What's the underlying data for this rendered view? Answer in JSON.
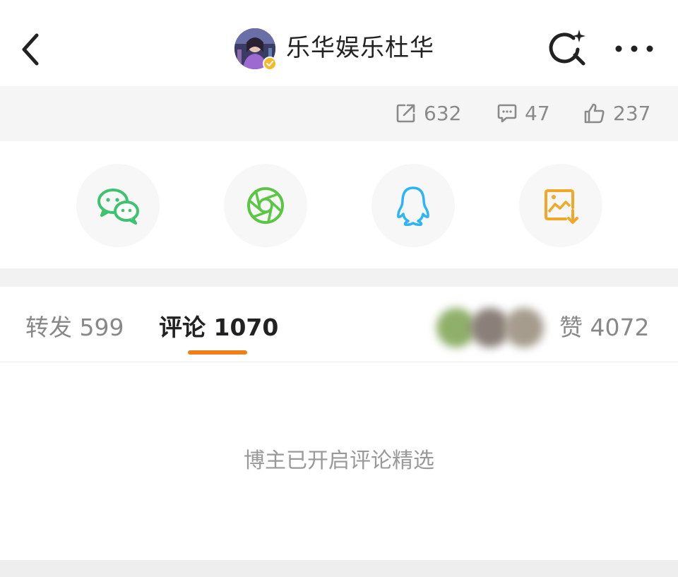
{
  "header": {
    "title": "乐华娱乐杜华",
    "back_icon": "chevron-left-icon",
    "search_icon": "search-sparkle-icon",
    "more_icon": "more-dots-icon",
    "verified_badge_color": "#f6b92b"
  },
  "stats": {
    "reposts": "632",
    "comments": "47",
    "likes": "237",
    "color": "#8a8a8a"
  },
  "share_targets": [
    {
      "name": "wechat",
      "icon": "wechat-icon",
      "color": "#3dc270"
    },
    {
      "name": "moments",
      "icon": "moments-icon",
      "color": "#59c743"
    },
    {
      "name": "qq",
      "icon": "qq-icon",
      "color": "#2db4f5"
    },
    {
      "name": "save-image",
      "icon": "save-image-icon",
      "color": "#f1a826"
    }
  ],
  "tabs": {
    "repost_label": "转发 599",
    "comment_label": "评论 1070",
    "likes_label": "赞 4072",
    "active": "comment",
    "indicator_color": "#ef7f1a"
  },
  "content": {
    "notice": "博主已开启评论精选"
  }
}
